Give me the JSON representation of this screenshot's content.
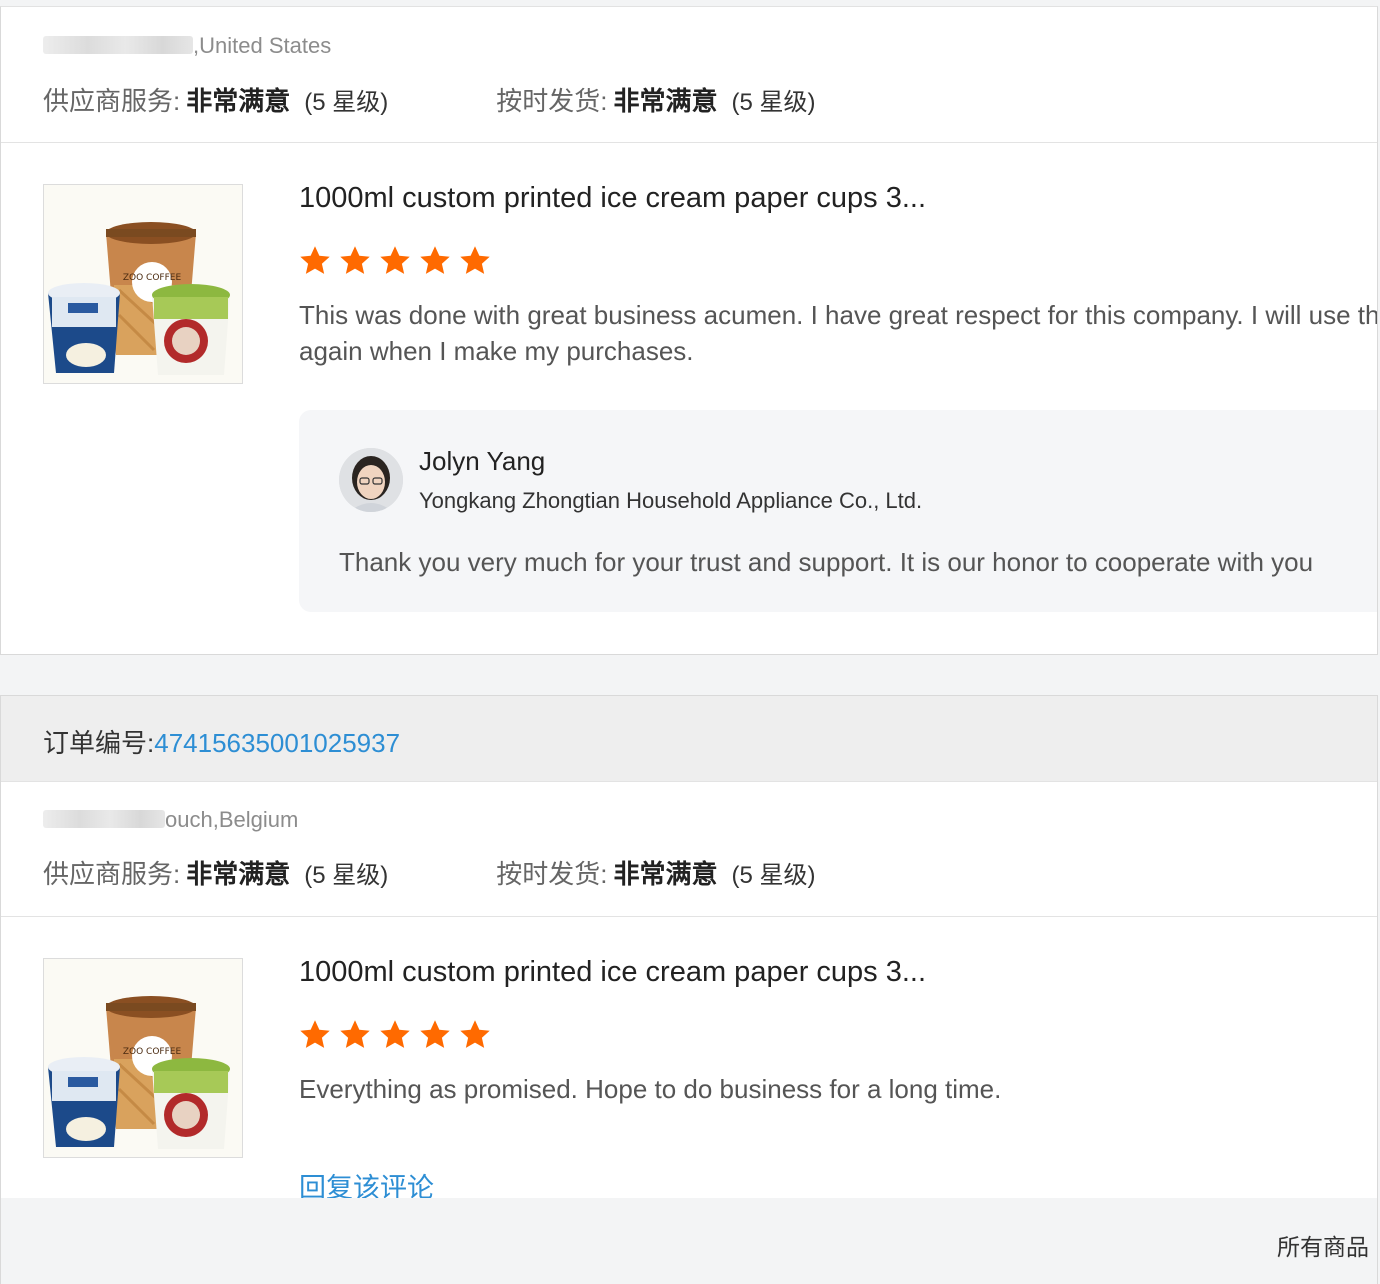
{
  "reviews": [
    {
      "buyer_suffix": ",United States",
      "ratings": {
        "supplier_label": "供应商服务:",
        "supplier_value": "非常满意",
        "supplier_stars": "(5 星级)",
        "shipping_label": "按时发货:",
        "shipping_value": "非常满意",
        "shipping_stars": "(5 星级)"
      },
      "product_title": "1000ml custom printed ice cream paper cups 3...",
      "star_rating": 5,
      "text": "This was done with great business acumen. I have great respect for this company. I will use them again when I make my purchases.",
      "reply": {
        "name": "Jolyn Yang",
        "company": "Yongkang Zhongtian Household Appliance Co., Ltd.",
        "text": "Thank you very much for your trust and support. It is our honor to cooperate with you"
      }
    },
    {
      "order_label": "订单编号:",
      "order_number": "47415635001025937",
      "buyer_suffix": "ouch,Belgium",
      "ratings": {
        "supplier_label": "供应商服务:",
        "supplier_value": "非常满意",
        "supplier_stars": "(5 星级)",
        "shipping_label": "按时发货:",
        "shipping_value": "非常满意",
        "shipping_stars": "(5 星级)"
      },
      "product_title": "1000ml custom printed ice cream paper cups 3...",
      "star_rating": 5,
      "text": "Everything as promised. Hope to do business for a long time.",
      "reply_link": "回复该评论"
    }
  ],
  "footer": {
    "all_products": "所有商品"
  },
  "colors": {
    "star": "#ff6a00",
    "link": "#2d8ed4"
  },
  "thumb_labels": {
    "cup_brand": "ZOO COFFEE"
  }
}
